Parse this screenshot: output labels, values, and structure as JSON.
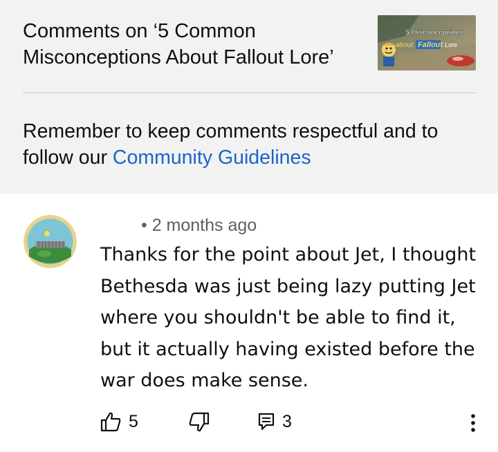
{
  "header": {
    "title": "Comments on ‘5 Common Misconceptions About Fallout Lore’",
    "thumbnail": {
      "line1": "5 Misconceptions",
      "about": "about",
      "fallout": "Fallout",
      "lore": "Lore"
    }
  },
  "guidelines": {
    "text_before": "Remember to keep comments respectful and to follow our ",
    "link": "Community Guidelines"
  },
  "comment": {
    "meta": "• 2 months ago",
    "text": "Thanks for the point about Jet, I thought Bethesda was just being lazy putting Jet where you shouldn't be able to find it, but it actually having existed before the war does make sense.",
    "likes": "5",
    "replies": "3"
  },
  "colors": {
    "link": "#1b64c8",
    "panel_bg": "#f2f2f2",
    "secondary_text": "#5f5f5f"
  },
  "icons": [
    "thumbs-up-icon",
    "thumbs-down-icon",
    "reply-icon",
    "more-vert-icon"
  ]
}
